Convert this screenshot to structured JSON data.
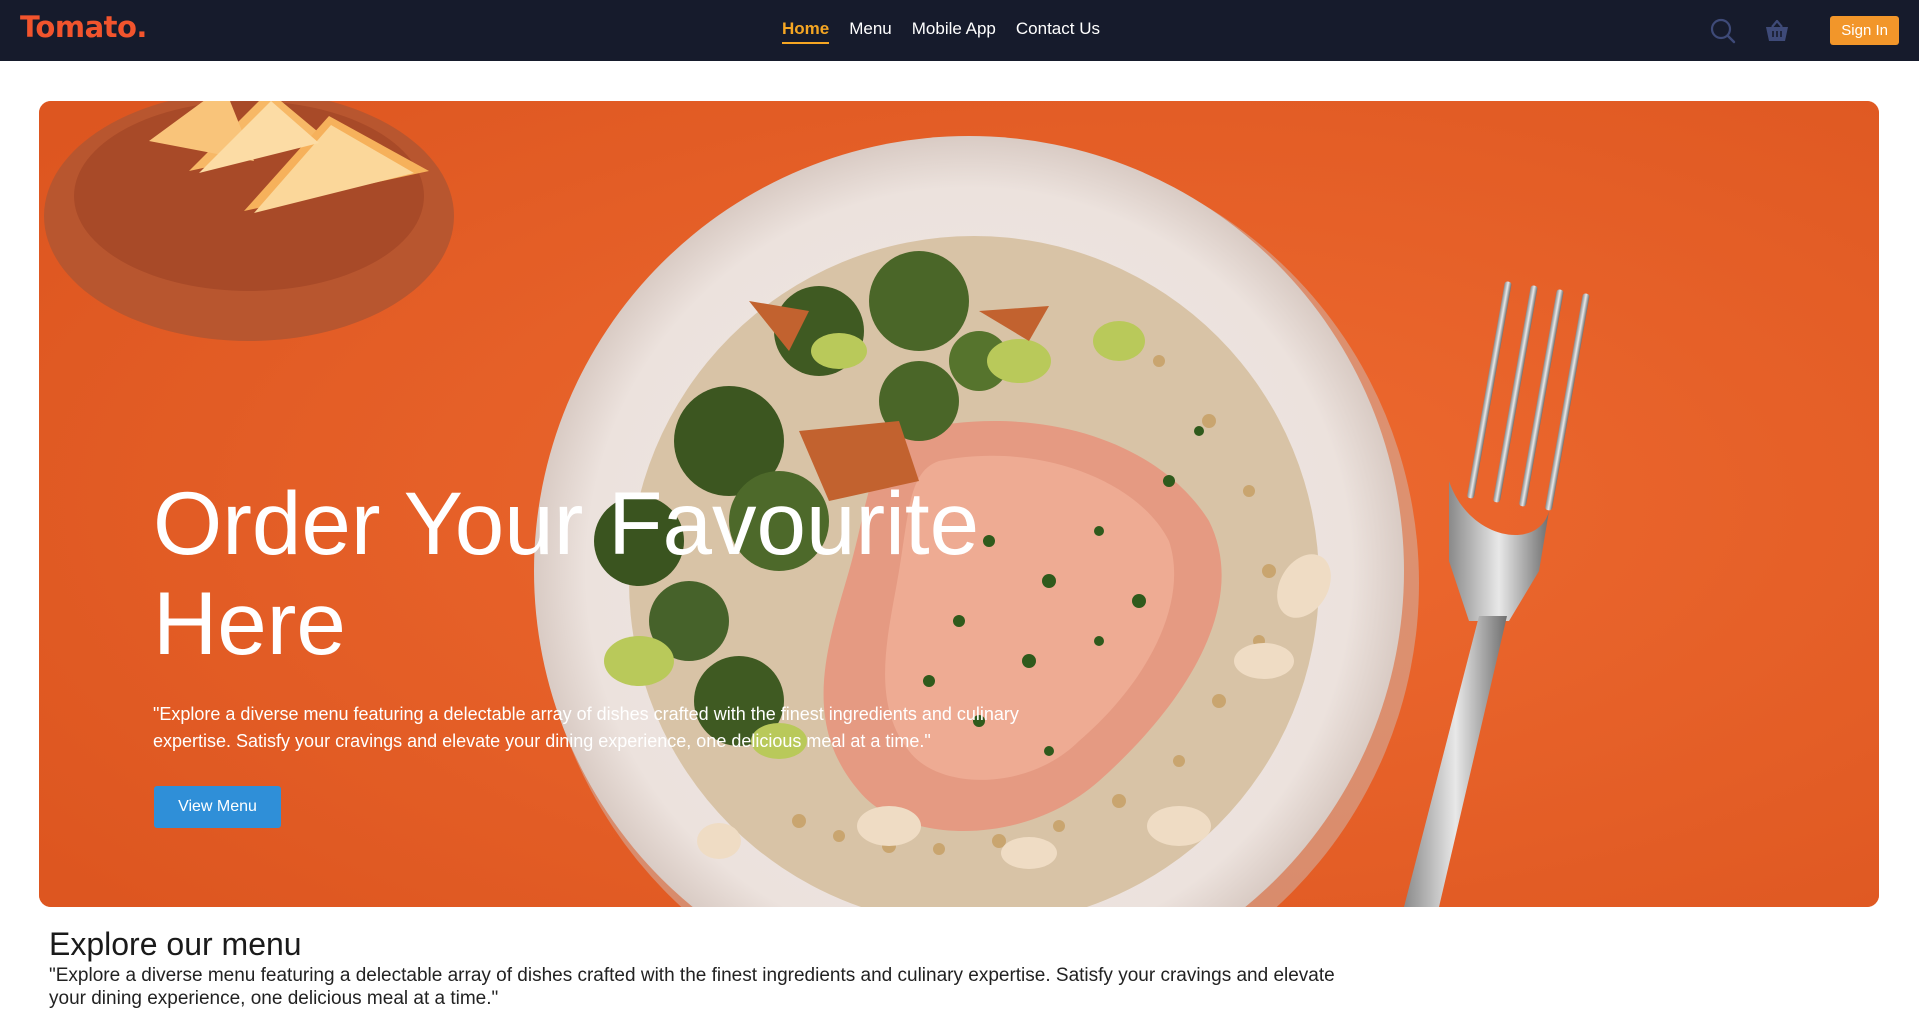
{
  "brand": {
    "name": "Tomato.",
    "accent": "#f2542d"
  },
  "nav": {
    "links": [
      {
        "label": "Home",
        "active": true
      },
      {
        "label": "Menu",
        "active": false
      },
      {
        "label": "Mobile App",
        "active": false
      },
      {
        "label": "Contact Us",
        "active": false
      }
    ],
    "active_color": "#f5a623",
    "background": "#161b2c",
    "icons": [
      "search-icon",
      "basket-icon"
    ],
    "signin_label": "Sign In",
    "signin_color": "#f2962a"
  },
  "hero": {
    "title": "Order Your Favourite Here",
    "description": "\"Explore a diverse menu featuring a delectable array of dishes crafted with the finest ingredients and culinary expertise. Satisfy your cravings and elevate your dining experience, one delicious meal at a time.\"",
    "button_label": "View Menu",
    "button_color": "#2f8fd8",
    "background_color": "#e8622a"
  },
  "explore": {
    "title": "Explore our menu",
    "description": "\"Explore a diverse menu featuring a delectable array of dishes crafted with the finest ingredients and culinary expertise. Satisfy your cravings and elevate your dining experience, one delicious meal at a time.\""
  }
}
